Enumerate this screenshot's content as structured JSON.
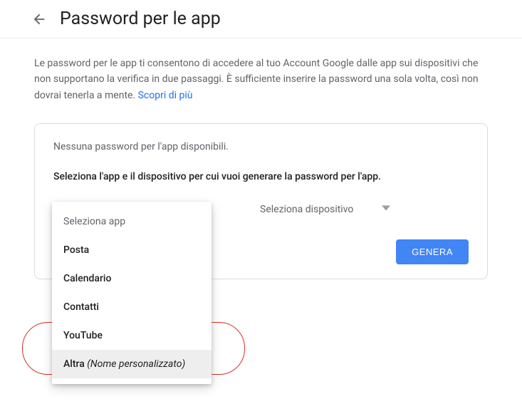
{
  "header": {
    "title": "Password per le app"
  },
  "description": {
    "text": "Le password per le app ti consentono di accedere al tuo Account Google dalle app sui dispositivi che non supportano la verifica in due passaggi. È sufficiente inserire la password una sola volta, così non dovrai tenerla a mente. ",
    "learn_more": "Scopri di più"
  },
  "card": {
    "no_passwords": "Nessuna password per l'app disponibili.",
    "prompt": "Seleziona l'app e il dispositivo per cui vuoi generare la password per l'app.",
    "app_trigger": "Seleziona app",
    "device_trigger": "Seleziona dispositivo",
    "generate": "GENERA"
  },
  "menu": {
    "header": "Seleziona app",
    "items": {
      "mail": "Posta",
      "calendar": "Calendario",
      "contacts": "Contatti",
      "youtube": "YouTube",
      "other_prefix": "Altra ",
      "other_suffix": "(Nome personalizzato)"
    }
  }
}
